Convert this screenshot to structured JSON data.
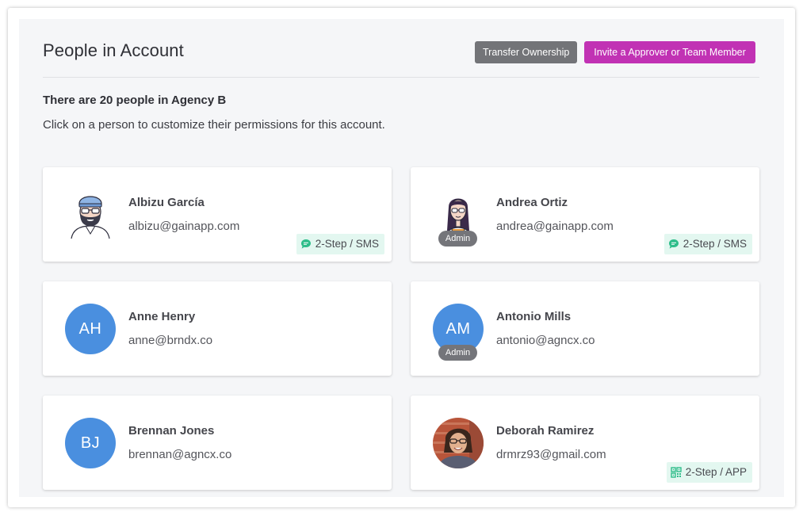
{
  "header": {
    "title": "People in Account",
    "transfer_label": "Transfer Ownership",
    "invite_label": "Invite a Approver or Team Member"
  },
  "summary": {
    "count_text": "There are 20 people in Agency B",
    "help_text": "Click on a person to customize their permissions for this account."
  },
  "people": [
    {
      "name": "Albizu García",
      "email": "albizu@gainapp.com",
      "avatar": "bearded-man-illustration",
      "admin": "",
      "twostep": "2-Step / SMS",
      "twostep_icon": "chat-bubble-icon"
    },
    {
      "name": "Andrea Ortiz",
      "email": "andrea@gainapp.com",
      "avatar": "woman-illustration",
      "admin": "Admin",
      "twostep": "2-Step / SMS",
      "twostep_icon": "chat-bubble-icon"
    },
    {
      "name": "Anne Henry",
      "email": "anne@brndx.co",
      "initials": "AH",
      "admin": "",
      "twostep": ""
    },
    {
      "name": "Antonio Mills",
      "email": "antonio@agncx.co",
      "initials": "AM",
      "admin": "Admin",
      "twostep": ""
    },
    {
      "name": "Brennan Jones",
      "email": "brennan@agncx.co",
      "initials": "BJ",
      "admin": "",
      "twostep": ""
    },
    {
      "name": "Deborah Ramirez",
      "email": "drmrz93@gmail.com",
      "avatar": "photo",
      "admin": "",
      "twostep": "2-Step / APP",
      "twostep_icon": "qr-code-icon"
    }
  ],
  "colors": {
    "accent": "#c132b4",
    "neutral_button": "#737478",
    "avatar_blue": "#4a8fdf",
    "twostep_bg": "#e3f7f0",
    "twostep_icon": "#2ebd8a"
  }
}
